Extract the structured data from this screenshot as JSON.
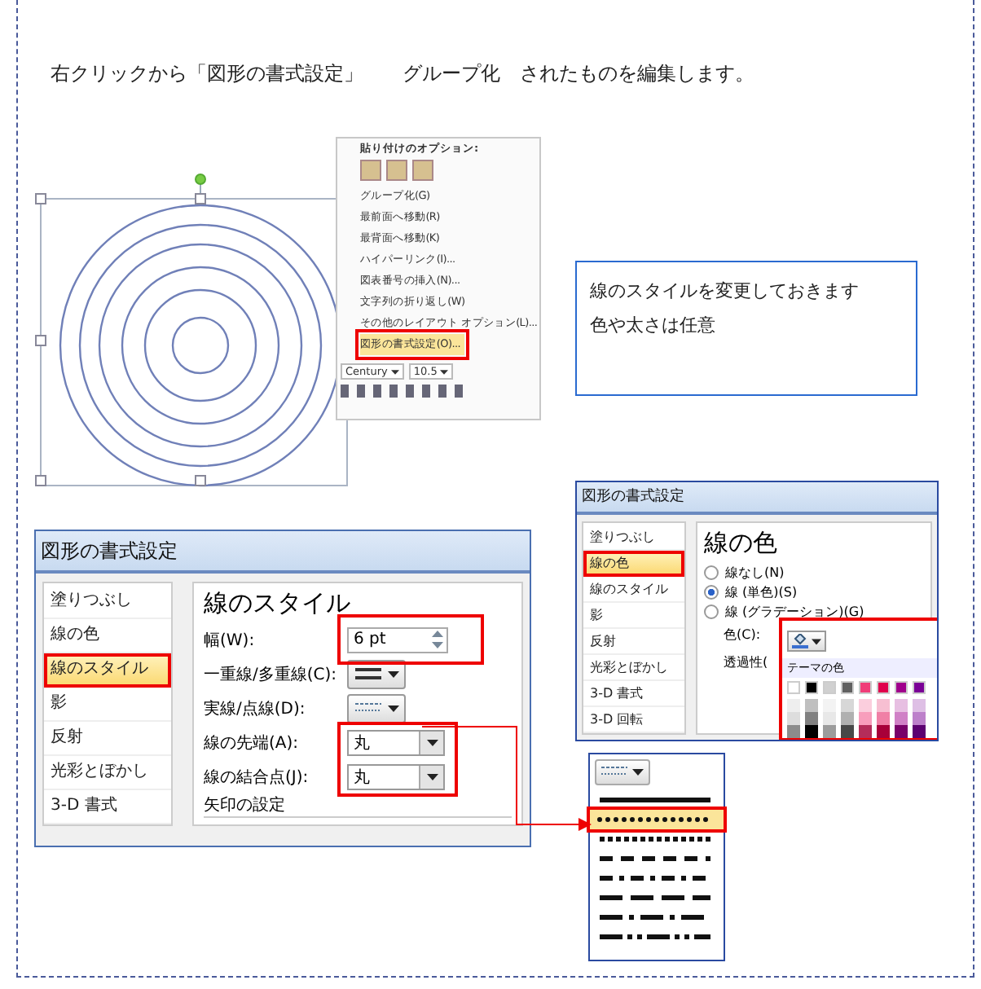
{
  "heading": "右クリックから「図形の書式設定」　　グループ化　されたものを編集します。",
  "context_menu": {
    "header": "貼り付けのオプション:",
    "items": [
      {
        "label": "グループ化(G)",
        "selected": false
      },
      {
        "label": "最前面へ移動(R)",
        "selected": false
      },
      {
        "label": "最背面へ移動(K)",
        "selected": false
      },
      {
        "label": "ハイパーリンク(I)...",
        "selected": false
      },
      {
        "label": "図表番号の挿入(N)...",
        "selected": false
      },
      {
        "label": "文字列の折り返し(W)",
        "selected": false
      },
      {
        "label": "その他のレイアウト オプション(L)...",
        "selected": false
      },
      {
        "label": "図形の書式設定(O)...",
        "selected": true
      }
    ],
    "font": "Century",
    "size": "10.5"
  },
  "note": {
    "lines": [
      "線のスタイルを変更しておきます",
      "色や太さは任意"
    ]
  },
  "style_dialog": {
    "title": "図形の書式設定",
    "sidebar": [
      {
        "label": "塗りつぶし",
        "selected": false
      },
      {
        "label": "線の色",
        "selected": false
      },
      {
        "label": "線のスタイル",
        "selected": true
      },
      {
        "label": "影",
        "selected": false
      },
      {
        "label": "反射",
        "selected": false
      },
      {
        "label": "光彩とぼかし",
        "selected": false
      },
      {
        "label": "3-D 書式",
        "selected": false
      }
    ],
    "heading": "線のスタイル",
    "width_label": "幅(W):",
    "width_value": "6 pt",
    "compound_label": "一重線/多重線(C):",
    "dash_label": "実線/点線(D):",
    "cap_label": "線の先端(A):",
    "cap_value": "丸",
    "join_label": "線の結合点(J):",
    "join_value": "丸",
    "arrow_section": "矢印の設定"
  },
  "color_dialog": {
    "title": "図形の書式設定",
    "sidebar": [
      {
        "label": "塗りつぶし",
        "selected": false
      },
      {
        "label": "線の色",
        "selected": true
      },
      {
        "label": "線のスタイル",
        "selected": false
      },
      {
        "label": "影",
        "selected": false
      },
      {
        "label": "反射",
        "selected": false
      },
      {
        "label": "光彩とぼかし",
        "selected": false
      },
      {
        "label": "3-D 書式",
        "selected": false
      },
      {
        "label": "3-D 回転",
        "selected": false
      }
    ],
    "heading": "線の色",
    "radios": [
      {
        "label": "線なし(N)",
        "selected": false
      },
      {
        "label": "線 (単色)(S)",
        "selected": true
      },
      {
        "label": "線 (グラデーション)(G)",
        "selected": false
      }
    ],
    "color_label": "色(C):",
    "transparency_label": "透過性(",
    "palette": {
      "title": "テーマの色",
      "colors": [
        {
          "color": "#ffffff"
        },
        {
          "color": "#000000"
        },
        {
          "color": "#d0d0d0"
        },
        {
          "color": "#606060"
        },
        {
          "color": "#f03c78"
        },
        {
          "color": "#e0004c"
        },
        {
          "color": "#a0008c"
        },
        {
          "color": "#7a0096"
        }
      ]
    }
  },
  "dash_menu": {
    "items": [
      {
        "kind": "solid",
        "selected": false
      },
      {
        "kind": "round-dot",
        "selected": true
      },
      {
        "kind": "square-dot",
        "selected": false
      },
      {
        "kind": "dash",
        "selected": false
      },
      {
        "kind": "dash-dot",
        "selected": false
      },
      {
        "kind": "long-dash",
        "selected": false
      },
      {
        "kind": "long-dash-dot",
        "selected": false
      },
      {
        "kind": "long-dash-dot-dot",
        "selected": false
      }
    ]
  }
}
